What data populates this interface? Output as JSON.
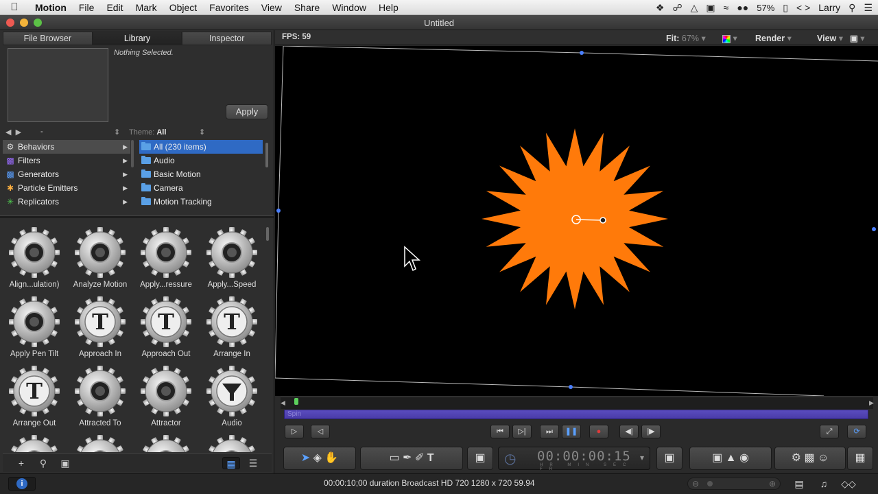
{
  "menubar": {
    "apple": "",
    "app_name": "Motion",
    "items": [
      "File",
      "Edit",
      "Mark",
      "Object",
      "Favorites",
      "View",
      "Share",
      "Window",
      "Help"
    ],
    "battery": "57%",
    "user": "Larry"
  },
  "window": {
    "title": "Untitled"
  },
  "left_panel": {
    "tabs": [
      "File Browser",
      "Library",
      "Inspector"
    ],
    "active_tab": "Library",
    "preview_text": "Nothing Selected.",
    "apply_label": "Apply",
    "nav_path": "-",
    "theme_label": "Theme:",
    "theme_value": "All",
    "categories": [
      {
        "label": "Behaviors",
        "icon": "gear-icon",
        "color": "#cccccc"
      },
      {
        "label": "Filters",
        "icon": "filters-icon",
        "color": "#9a6cff"
      },
      {
        "label": "Generators",
        "icon": "generators-icon",
        "color": "#5aa0ff"
      },
      {
        "label": "Particle Emitters",
        "icon": "particle-icon",
        "color": "#ffb040"
      },
      {
        "label": "Replicators",
        "icon": "replicator-icon",
        "color": "#50d050"
      }
    ],
    "folders": [
      "All (230 items)",
      "Audio",
      "Basic Motion",
      "Camera",
      "Motion Tracking"
    ],
    "grid_items": [
      {
        "label": "Align...ulation)",
        "icon": "gear-icon"
      },
      {
        "label": "Analyze Motion",
        "icon": "gear-icon"
      },
      {
        "label": "Apply...ressure",
        "icon": "gear-icon"
      },
      {
        "label": "Apply...Speed",
        "icon": "gear-icon"
      },
      {
        "label": "Apply Pen Tilt",
        "icon": "gear-icon"
      },
      {
        "label": "Approach In",
        "icon": "gear-t-icon"
      },
      {
        "label": "Approach Out",
        "icon": "gear-t-icon"
      },
      {
        "label": "Arrange In",
        "icon": "gear-t-icon"
      },
      {
        "label": "Arrange Out",
        "icon": "gear-t-icon"
      },
      {
        "label": "Attracted To",
        "icon": "gear-icon"
      },
      {
        "label": "Attractor",
        "icon": "gear-icon"
      },
      {
        "label": "Audio",
        "icon": "gear-funnel-icon"
      }
    ]
  },
  "canvas": {
    "fps_label": "FPS: 59",
    "fit_label": "Fit:",
    "fit_value": "67%",
    "render_label": "Render",
    "view_label": "View",
    "star_color": "#ff7a0a",
    "behavior_bar": "Spin"
  },
  "toolbar": {
    "timecode": "00:00:00:15",
    "timecode_units": "HR MIN SEC FR"
  },
  "status": {
    "info": "i",
    "text": "00:00:10;00 duration Broadcast HD 720 1280 x 720 59.94"
  }
}
